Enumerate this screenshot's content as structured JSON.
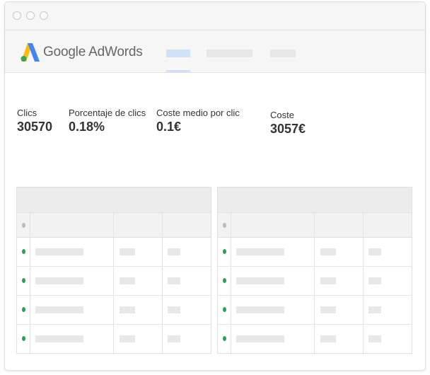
{
  "brand": {
    "name": "Google AdWords",
    "logo_colors": {
      "blue": "#4285f4",
      "yellow": "#fbbc04",
      "green": "#34a853"
    }
  },
  "titlebar": {
    "buttons": [
      "close-dot",
      "minimize-dot",
      "maximize-dot"
    ]
  },
  "nav": {
    "tab_count": 3,
    "active_tab_index": 0,
    "active_color": "#cfe2f8",
    "inactive_color": "#e7e7e7"
  },
  "metrics": [
    {
      "label": "Clics",
      "value": "30570"
    },
    {
      "label": "Porcentaje de clics",
      "value": "0.18%"
    },
    {
      "label": "Coste medio por clic",
      "value": "0.1€"
    },
    {
      "label": "Coste",
      "value": "3057€"
    }
  ],
  "tables": [
    {
      "header_dot_color": "#bbbbbb",
      "row_dot_color": "#21a55a",
      "row_count": 4
    },
    {
      "header_dot_color": "#bbbbbb",
      "row_dot_color": "#21a55a",
      "row_count": 4
    }
  ]
}
